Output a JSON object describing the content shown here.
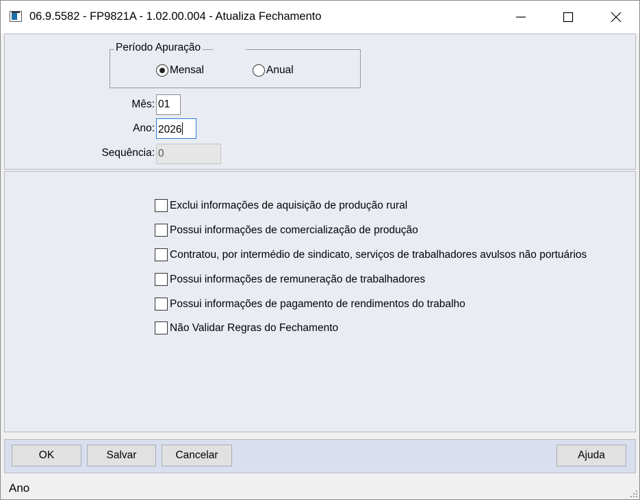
{
  "window": {
    "title": "06.9.5582 - FP9821A - 1.02.00.004 - Atualiza Fechamento"
  },
  "periodo": {
    "legend": "Período Apuração",
    "options": [
      {
        "label": "Mensal",
        "selected": true
      },
      {
        "label": "Anual",
        "selected": false
      }
    ]
  },
  "fields": {
    "mes": {
      "label": "Mês:",
      "value": "01"
    },
    "ano": {
      "label": "Ano:",
      "value": "2026"
    },
    "sequencia": {
      "label": "Sequência:",
      "value": "0"
    }
  },
  "checkboxes": [
    {
      "label": "Exclui informações de aquisição de produção rural",
      "checked": false
    },
    {
      "label": "Possui informações de comercialização de produção",
      "checked": false
    },
    {
      "label": "Contratou, por intermédio de sindicato, serviços de trabalhadores avulsos não portuários",
      "checked": false
    },
    {
      "label": "Possui informações de remuneração de trabalhadores",
      "checked": false
    },
    {
      "label": "Possui informações de pagamento de rendimentos do trabalho",
      "checked": false
    },
    {
      "label": "Não Validar Regras do Fechamento",
      "checked": false
    }
  ],
  "buttons": {
    "ok": "OK",
    "salvar": "Salvar",
    "cancelar": "Cancelar",
    "ajuda": "Ajuda"
  },
  "status": {
    "text": "Ano"
  },
  "colors": {
    "panel_bg": "#e9ecf3",
    "button_panel_bg": "#d9dfee",
    "focus_border": "#2b7cd3"
  }
}
